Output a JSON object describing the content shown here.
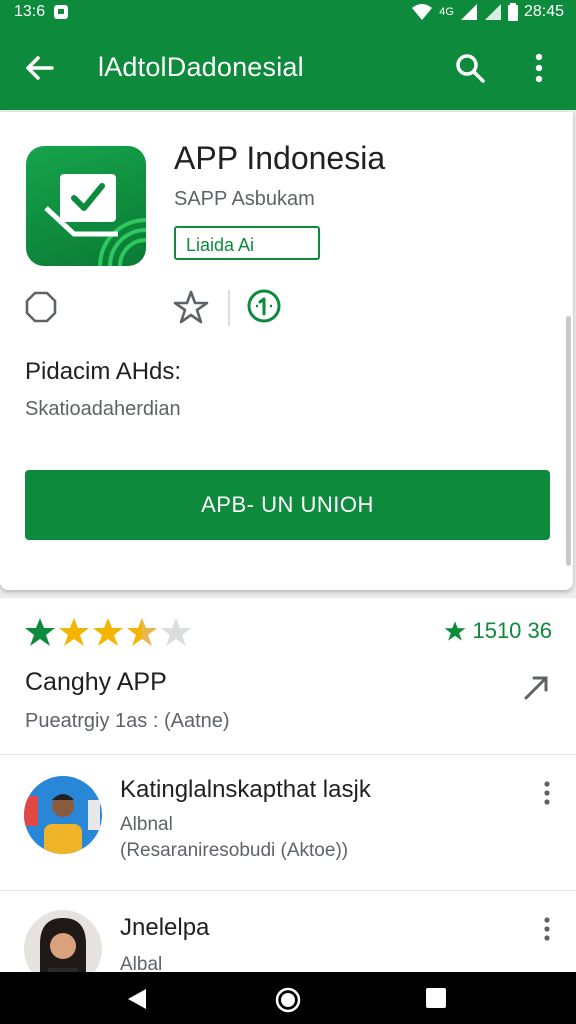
{
  "status_bar": {
    "left_text": "13:6",
    "right_text": "28:45",
    "signal_text": "4G"
  },
  "toolbar": {
    "title": "lAdtolDadonesial",
    "back_icon": "arrow-back-icon",
    "search_icon": "search-icon",
    "more_icon": "more-vert-icon"
  },
  "app": {
    "name": "APP Indonesia",
    "developer": "SAPP Asbukam",
    "badge": "Liaida Ai",
    "icon": "checkbox-icon",
    "action_icons": [
      "shield-icon",
      "wishlist-star-icon",
      "info-icon"
    ]
  },
  "section": {
    "title": "Pidacim AHds:",
    "subtitle": "Skatioadaherdian"
  },
  "install_button": {
    "label": "APB- UN UNIOH"
  },
  "rating": {
    "stars": 3.5,
    "count": "1510 36",
    "star_color": "#f4b400",
    "accent": "#0d8a3c"
  },
  "review_section": {
    "title": "Canghy APP",
    "subtitle": "Pueatrgiy 1as : (Aatne)"
  },
  "reviews": [
    {
      "name": "Katinglalnskapthat lasjk",
      "line1": "Albnal",
      "line2": "(Resaraniresobudi (Aktoe))"
    },
    {
      "name": "Jnelelpa",
      "line1": "Albal",
      "line2": ""
    }
  ],
  "nav": {
    "icons": [
      "back-icon",
      "home-icon",
      "recents-icon"
    ]
  }
}
